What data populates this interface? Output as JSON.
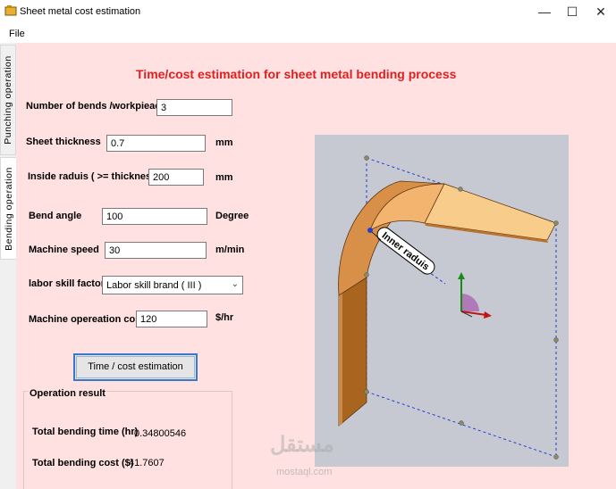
{
  "window": {
    "title": "Sheet metal cost estimation",
    "minimize_glyph": "—",
    "maximize_glyph": "☐",
    "close_glyph": "✕"
  },
  "menu": {
    "file": "File"
  },
  "tabs": {
    "punching": "Punching operation",
    "bending": "Bending operation"
  },
  "form": {
    "heading": "Time/cost estimation for sheet metal bending process",
    "bends_label": "Number of bends /workpieace",
    "bends_value": "3",
    "thickness_label": "Sheet thickness",
    "thickness_value": "0.7",
    "thickness_unit": "mm",
    "radius_label": "Inside raduis ( >= thickness)",
    "radius_value": "200",
    "radius_unit": "mm",
    "angle_label": "Bend angle",
    "angle_value": "100",
    "angle_unit": "Degree",
    "speed_label": "Machine speed",
    "speed_value": "30",
    "speed_unit": "m/min",
    "skill_label": "labor skill factor",
    "skill_value": "Labor skill brand  ( III )",
    "cost_label": "Machine opereation cost",
    "cost_value": "120",
    "cost_unit": "$/hr",
    "estimate_button": "Time / cost estimation"
  },
  "result": {
    "legend": "Operation result",
    "time_label": "Total bending time (hr)",
    "time_value": "0.34800546",
    "cost_label": "Total bending cost ($)",
    "cost_value": "41.7607"
  },
  "illustration": {
    "callout": "Inner raduis",
    "colors": {
      "sheet_top": "#f8cd8c",
      "sheet_side": "#b9732f",
      "bbox": "#1f3fd6",
      "background": "#c7c9d2"
    }
  },
  "watermark": {
    "arabic": "مستقل",
    "latin": "mostaql.com"
  }
}
